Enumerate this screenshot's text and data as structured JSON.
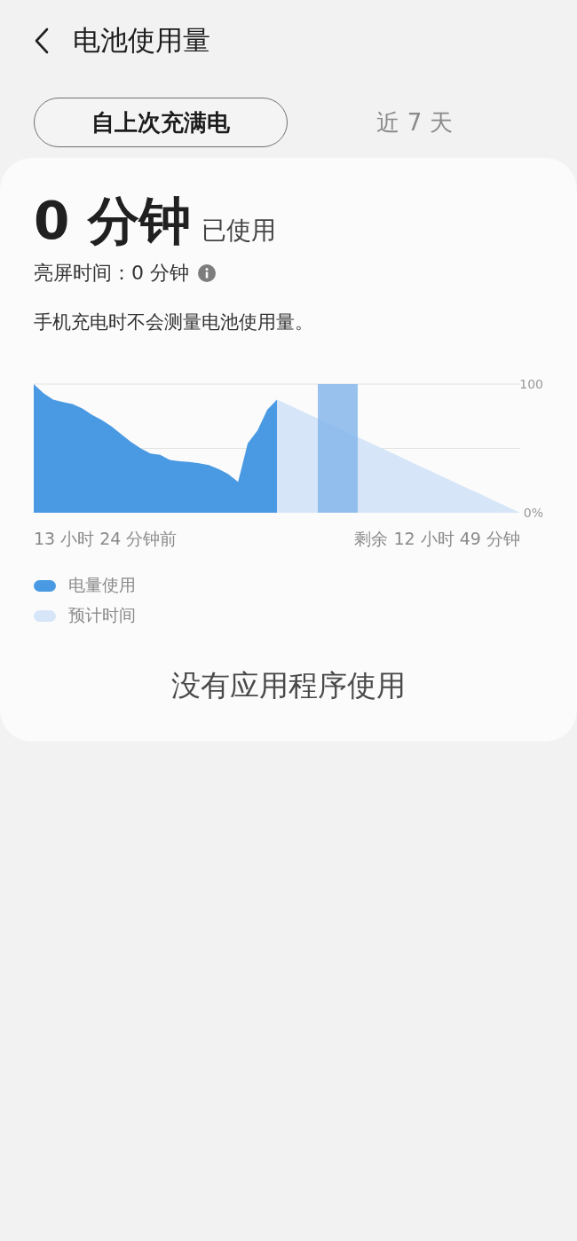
{
  "header": {
    "title": "电池使用量"
  },
  "tabs": [
    {
      "label": "自上次充满电",
      "selected": true
    },
    {
      "label": "近 7 天",
      "selected": false
    }
  ],
  "summary": {
    "value": "0 分钟",
    "suffix": "已使用",
    "screen_time": "亮屏时间：0 分钟",
    "note": "手机充电时不会测量电池使用量。"
  },
  "chart": {
    "axis_labels": [
      "100",
      "0%"
    ],
    "time_labels": [
      "13 小时 24 分钟前",
      "剩余 12 小时 49 分钟"
    ],
    "legend": [
      {
        "label": "电量使用",
        "color": "#4a9ae3"
      },
      {
        "label": "预计时间",
        "color": "#d6e6f8"
      }
    ]
  },
  "empty_message": "没有应用程序使用"
}
